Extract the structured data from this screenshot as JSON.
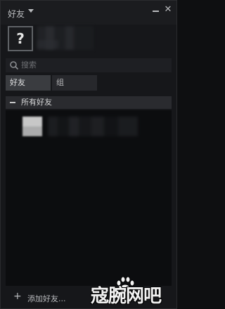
{
  "titlebar": {
    "title": "好友",
    "close_glyph": "✕"
  },
  "profile": {
    "avatar_glyph": "?"
  },
  "search": {
    "placeholder": "搜索"
  },
  "tabs": [
    {
      "label": "好友",
      "active": true
    },
    {
      "label": "组",
      "active": false
    }
  ],
  "section": {
    "label": "所有好友"
  },
  "footer": {
    "add_icon": "+",
    "add_label": "添加好友..."
  },
  "watermark": {
    "text": "寇腕网吧"
  },
  "colors": {
    "background": "#16171a",
    "list_background": "#0c0d0f",
    "active_tab": "#3a3c40",
    "inactive_tab": "#27282c",
    "text": "#c6c7c8"
  }
}
